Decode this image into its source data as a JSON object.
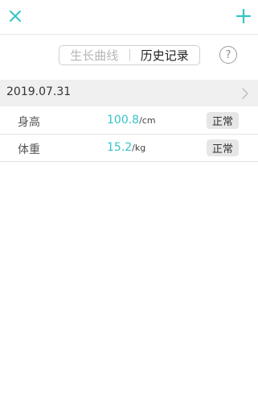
{
  "header": {
    "close_icon": "close-icon",
    "add_icon": "plus-icon"
  },
  "segmented": {
    "tabs": [
      {
        "label": "生长曲线",
        "active": false
      },
      {
        "label": "历史记录",
        "active": true
      }
    ]
  },
  "help": {
    "label": "?"
  },
  "history": {
    "date": "2019.07.31",
    "records": [
      {
        "label": "身高",
        "value": "100.8",
        "unit": "/cm",
        "status": "正常"
      },
      {
        "label": "体重",
        "value": "15.2",
        "unit": "/kg",
        "status": "正常"
      }
    ]
  },
  "colors": {
    "accent": "#35c4c8",
    "badge_bg": "#e6e6e6"
  }
}
